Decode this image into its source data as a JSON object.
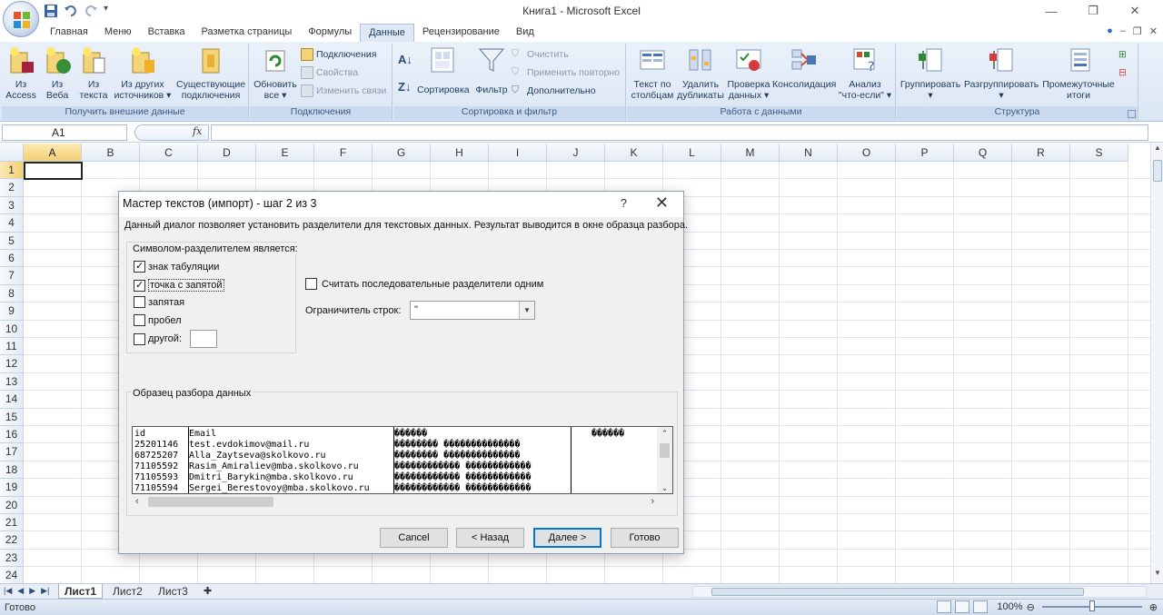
{
  "window": {
    "title": "Книга1 - Microsoft Excel",
    "controls": [
      "—",
      "❐",
      "✕"
    ]
  },
  "ribbon_tabs": [
    "Главная",
    "Меню",
    "Вставка",
    "Разметка страницы",
    "Формулы",
    "Данные",
    "Рецензирование",
    "Вид"
  ],
  "active_tab": "Данные",
  "groups": {
    "external": {
      "label": "Получить внешние данные",
      "buttons": [
        {
          "line1": "Из",
          "line2": "Access"
        },
        {
          "line1": "Из",
          "line2": "Веба"
        },
        {
          "line1": "Из",
          "line2": "текста"
        },
        {
          "line1": "Из других",
          "line2": "источников ▾"
        },
        {
          "line1": "Существующие",
          "line2": "подключения"
        }
      ]
    },
    "connections": {
      "label": "Подключения",
      "refresh": {
        "line1": "Обновить",
        "line2": "все ▾"
      },
      "small": [
        "Подключения",
        "Свойства",
        "Изменить связи"
      ]
    },
    "sort": {
      "label": "Сортировка и фильтр",
      "sort_btn": "Сортировка",
      "filter_btn": "Фильтр",
      "small": [
        "Очистить",
        "Применить повторно",
        "Дополнительно"
      ]
    },
    "datatools": {
      "label": "Работа с данными",
      "buttons": [
        {
          "line1": "Текст по",
          "line2": "столбцам"
        },
        {
          "line1": "Удалить",
          "line2": "дубликаты"
        },
        {
          "line1": "Проверка",
          "line2": "данных ▾"
        },
        {
          "line1": "Консолидация",
          "line2": ""
        },
        {
          "line1": "Анализ",
          "line2": "\"что-если\" ▾"
        }
      ]
    },
    "outline": {
      "label": "Структура",
      "buttons": [
        {
          "line1": "Группировать",
          "line2": "▾"
        },
        {
          "line1": "Разгруппировать",
          "line2": "▾"
        },
        {
          "line1": "Промежуточные",
          "line2": "итоги"
        }
      ]
    }
  },
  "formula_bar": {
    "name_box": "A1",
    "fx": "fx",
    "formula": ""
  },
  "columns": [
    "A",
    "B",
    "C",
    "D",
    "E",
    "F",
    "G",
    "H",
    "I",
    "J",
    "K",
    "L",
    "M",
    "N",
    "O",
    "P",
    "Q",
    "R",
    "S"
  ],
  "rows": [
    "1",
    "2",
    "3",
    "4",
    "5",
    "6",
    "7",
    "8",
    "9",
    "10",
    "11",
    "12",
    "13",
    "14",
    "15",
    "16",
    "17",
    "18",
    "19",
    "20",
    "21",
    "22",
    "23",
    "24"
  ],
  "sheets": [
    "Лист1",
    "Лист2",
    "Лист3"
  ],
  "active_sheet": "Лист1",
  "status": {
    "ready": "Готово",
    "zoom": "100%"
  },
  "dialog": {
    "title": "Мастер текстов (импорт) - шаг 2 из 3",
    "help": "?",
    "close": "✕",
    "description": "Данный диалог позволяет установить разделители для текстовых данных. Результат выводится в окне образца разбора.",
    "delimiters_legend": "Символом-разделителем является:",
    "delimiters": [
      {
        "label": "знак табуляции",
        "checked": true
      },
      {
        "label": "точка с запятой",
        "checked": true
      },
      {
        "label": "запятая",
        "checked": false
      },
      {
        "label": "пробел",
        "checked": false
      },
      {
        "label": "другой:",
        "checked": false
      }
    ],
    "consecutive": {
      "label": "Считать последовательные разделители одним",
      "checked": false
    },
    "text_qualifier": {
      "label": "Ограничитель строк:",
      "value": "\""
    },
    "preview_legend": "Образец разбора данных",
    "preview_columns": [
      [
        "id",
        "25201146",
        "68725207",
        "71105592",
        "71105593",
        "71105594"
      ],
      [
        "Email",
        "test.evdokimov@mail.ru",
        "Alla_Zaytseva@skolkovo.ru",
        "Rasim_Amiraliev@mba.skolkovo.ru",
        "Dmitri_Barykin@mba.skolkovo.ru",
        "Sergei_Berestovoy@mba.skolkovo.ru"
      ],
      [
        "������",
        "�������� ��������������",
        "�������� ��������������",
        "������������ ������������",
        "������������ ������������",
        "������������ ������������"
      ],
      [
        "������",
        "",
        "",
        "",
        "",
        ""
      ]
    ],
    "buttons": {
      "cancel": "Cancel",
      "back": "< Назад",
      "next": "Далее >",
      "finish": "Готово"
    }
  }
}
